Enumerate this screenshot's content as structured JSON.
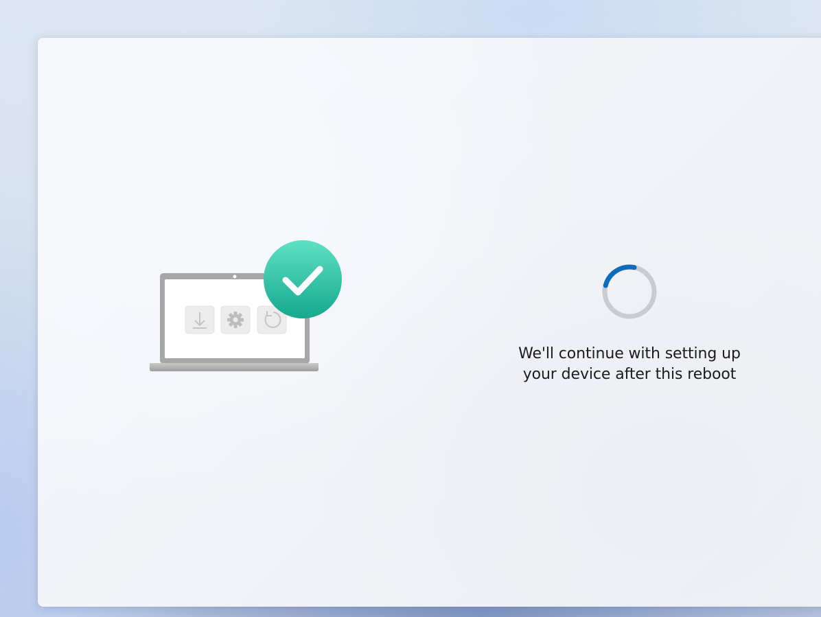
{
  "screen": {
    "status_line_1": "We'll continue with setting up",
    "status_line_2": "your device after this reboot"
  },
  "spinner": {
    "track_color": "#c8cbd0",
    "arc_color": "#0f6cbd"
  },
  "illustration": {
    "badge_color": "#2bc2a4",
    "icons": [
      "download-icon",
      "gear-icon",
      "restart-icon"
    ]
  }
}
